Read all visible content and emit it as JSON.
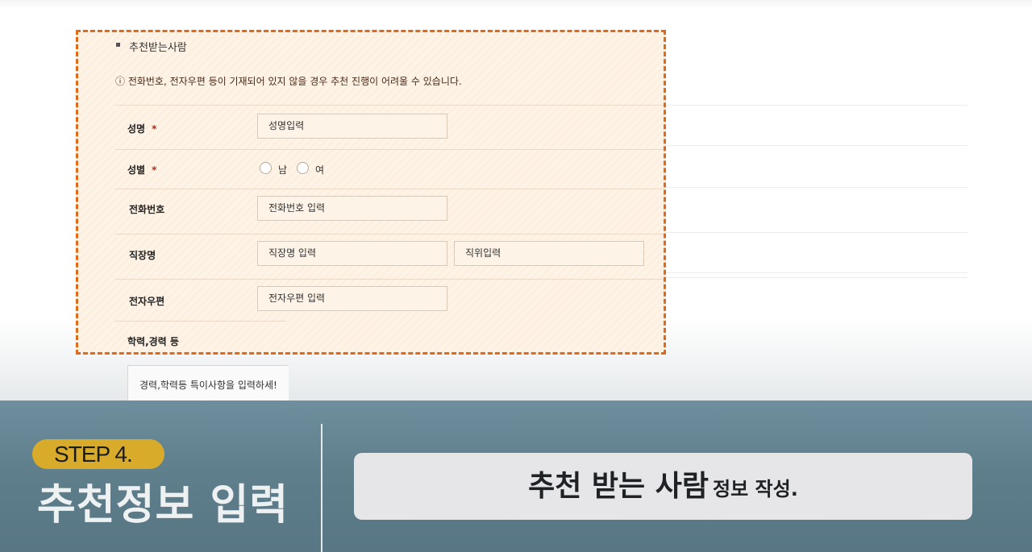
{
  "section": {
    "title": "추천받는사람",
    "notice": "ⓘ 전화번호, 전자우편 등이 기재되어 있지 않을 경우 추천 진행이 어려울 수 있습니다."
  },
  "form": {
    "required_mark": "*",
    "name": {
      "label": "성명",
      "placeholder": "성명입력"
    },
    "gender": {
      "label": "성별",
      "option_male": "남",
      "option_female": "여"
    },
    "phone": {
      "label": "전화번호",
      "placeholder": "전화번호 입력"
    },
    "workplace": {
      "label": "직장명",
      "placeholder": "직장명 입력",
      "position_placeholder": "직위입력"
    },
    "email": {
      "label": "전자우편",
      "placeholder": "전자우편 입력"
    },
    "career": {
      "label": "학력,경력 등",
      "placeholder": "경력,학력등 특이사항을 입력하세!"
    }
  },
  "overlay": {
    "step_badge": "STEP 4.",
    "step_title": "추천정보 입력",
    "caption_main": "추천 받는 사람",
    "caption_sub": "정보 작성."
  },
  "colors": {
    "highlight_border": "#e06a1c",
    "step_badge": "#d8ac2a",
    "band": "#6f8f9e"
  }
}
